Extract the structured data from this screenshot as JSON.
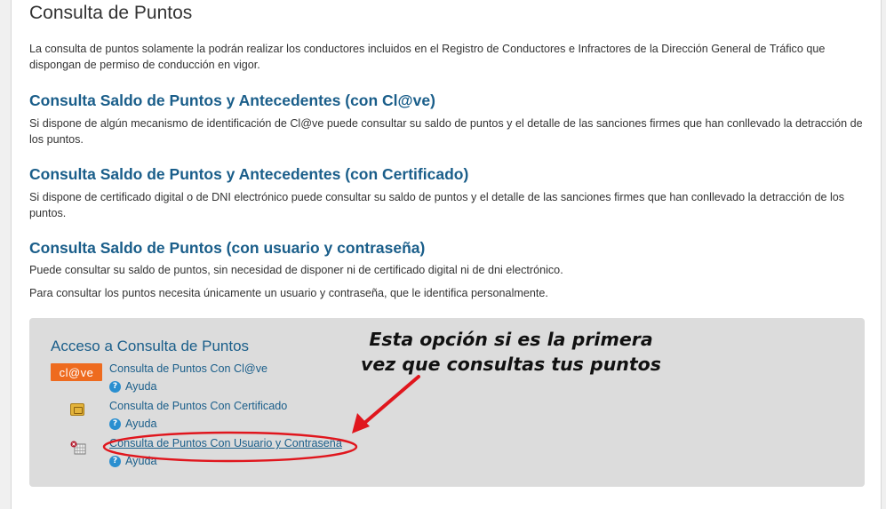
{
  "page": {
    "title": "Consulta de Puntos",
    "intro": "La consulta de puntos solamente la podrán realizar los conductores incluidos en el Registro de Conductores e Infractores de la Dirección General de Tráfico que dispongan de permiso de conducción en vigor."
  },
  "sections": {
    "clave": {
      "heading": "Consulta Saldo de Puntos y Antecedentes (con Cl@ve)",
      "text": "Si dispone de algún mecanismo de identificación de Cl@ve puede consultar su saldo de puntos y el detalle de las sanciones firmes que han conllevado la detracción de los puntos."
    },
    "cert": {
      "heading": "Consulta Saldo de Puntos y Antecedentes (con Certificado)",
      "text": "Si dispone de certificado digital o de DNI electrónico puede consultar su saldo de puntos y el detalle de las sanciones firmes que han conllevado la detracción de los puntos."
    },
    "user": {
      "heading": "Consulta Saldo de Puntos (con usuario y contraseña)",
      "text1": "Puede consultar su saldo de puntos, sin necesidad de disponer ni de certificado digital ni de dni electrónico.",
      "text2": "Para consultar los puntos necesita únicamente un usuario y contraseña, que le identifica personalmente."
    }
  },
  "access": {
    "title": "Acceso a Consulta de Puntos",
    "clave_logo": "cl@ve",
    "options": [
      {
        "label": "Consulta de Puntos Con Cl@ve",
        "help": "Ayuda",
        "icon": "clave-logo"
      },
      {
        "label": "Consulta de Puntos Con Certificado",
        "help": "Ayuda",
        "icon": "chip-card-icon"
      },
      {
        "label": "Consulta de Puntos Con Usuario y Contraseña",
        "help": "Ayuda",
        "icon": "user-password-icon"
      }
    ]
  },
  "annotation": {
    "line1": "Esta opción si es la primera",
    "line2": "vez que consultas tus puntos",
    "color": "#e0161d"
  },
  "colors": {
    "link": "#1a5e8a",
    "panel": "#dcdcdc",
    "clave": "#ee6b1f",
    "help": "#2a8fd0"
  }
}
